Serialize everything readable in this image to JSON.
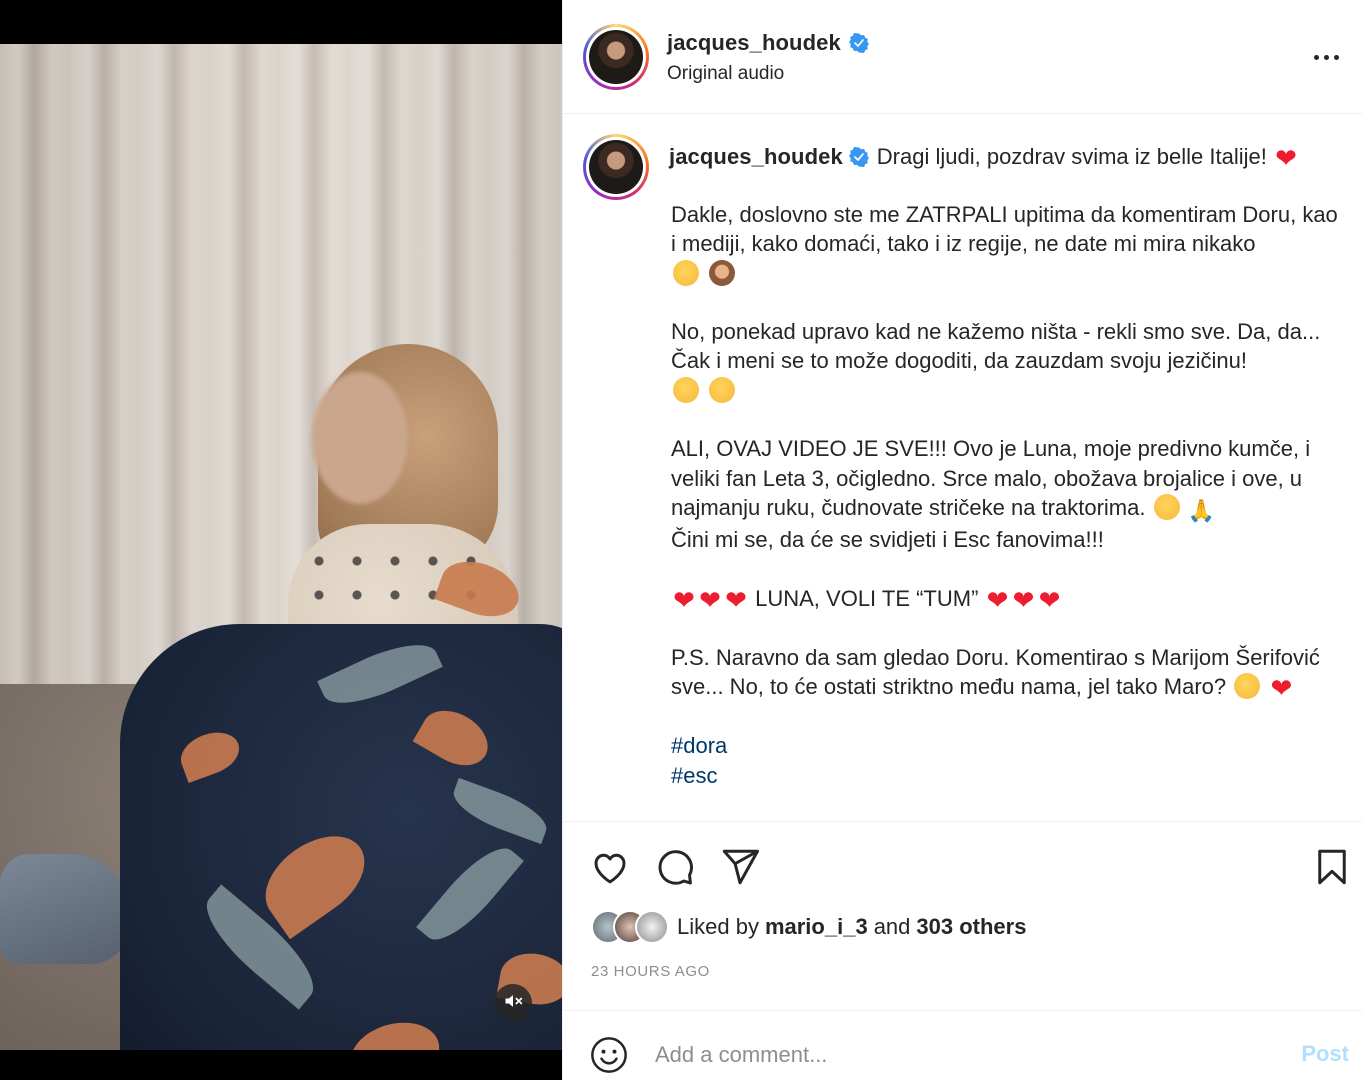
{
  "post": {
    "username": "jacques_houdek",
    "audio": "Original audio",
    "more_icon": "more-horizontal-icon"
  },
  "caption": {
    "username": "jacques_houdek",
    "line1": "Dragi ljudi, pozdrav svima iz belle Italije!",
    "para1": "Dakle, doslovno ste me ZATRPALI upitima da komentiram Doru, kao i mediji, kako domaći, tako i iz regije, ne date mi mira nikako",
    "para2": "No, ponekad upravo kad ne kažemo ništa - rekli smo sve. Da, da... Čak i meni se to može dogoditi, da zauzdam svoju jezičinu!",
    "para3a": "ALI, OVAJ VIDEO JE SVE!!! Ovo je Luna, moje predivno kumče, i veliki fan Leta 3, očigledno. Srce malo, obožava brojalice i ove, u najmanju ruku, čudnovate stričeke na traktorima.",
    "para3b": "Čini mi se, da će se svidjeti i Esc fanovima!!!",
    "para4": "LUNA, VOLI TE “TUM”",
    "para5": "P.S. Naravno da sam gledao Doru. Komentirao s Marijom Šerifović sve... No, to će ostati striktno među nama, jel tako Maro?",
    "hashtags": [
      "#dora",
      "#esc"
    ]
  },
  "likes": {
    "prefix": "Liked by",
    "user": "mario_i_3",
    "connector": "and",
    "others": "303 others"
  },
  "timestamp": "23 HOURS AGO",
  "comment": {
    "placeholder": "Add a comment...",
    "post_label": "Post"
  },
  "colors": {
    "heart": "#ed1c2e",
    "verified": "#3897f0",
    "hashtag": "#00376b",
    "post_disabled": "#b2dffc"
  }
}
